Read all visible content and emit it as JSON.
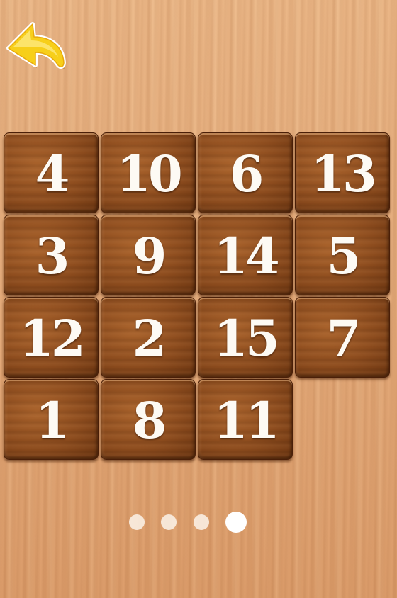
{
  "back_button": {
    "icon": "curved-back-arrow-icon",
    "color": "#f7cf1a"
  },
  "board": {
    "rows": 4,
    "columns": 4,
    "tiles": [
      "4",
      "10",
      "6",
      "13",
      "3",
      "9",
      "14",
      "5",
      "12",
      "2",
      "15",
      "7",
      "1",
      "8",
      "11",
      ""
    ]
  },
  "pager": {
    "page_count": 4,
    "active_page": 4
  },
  "colors": {
    "tile_wood": "#8c4b1d",
    "tile_text": "#fdfaf4",
    "background_wood": "#e6ae7e"
  }
}
